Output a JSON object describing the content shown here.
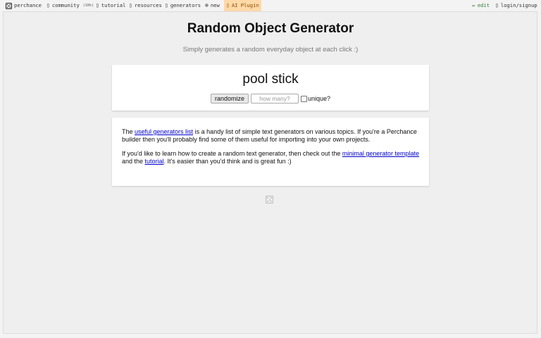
{
  "nav": {
    "brand": "perchance",
    "community": "community",
    "community_count": "(10h)",
    "tutorial": "tutorial",
    "resources": "resources",
    "generators": "generators",
    "new": "new",
    "ai_plugin": "AI Plugin",
    "edit": "edit",
    "login": "login/signup"
  },
  "page": {
    "title": "Random Object Generator",
    "subtitle": "Simply generates a random everyday object at each click :)"
  },
  "generator": {
    "result": "pool stick",
    "randomize_label": "randomize",
    "count_placeholder": "how many?",
    "unique_label": "unique?"
  },
  "info": {
    "p1_before": "The ",
    "p1_link": "useful generators list",
    "p1_after": " is a handy list of simple text generators on various topics. If you're a Perchance builder then you'll probably find some of them useful for importing into your own projects.",
    "p2_before": "If you'd like to learn how to create a random text generator, then check out the ",
    "p2_link1": "minimal generator template",
    "p2_mid": " and the ",
    "p2_link2": "tutorial",
    "p2_after": ". It's easier than you'd think and is great fun :)"
  },
  "icons": {
    "brand": "dice-icon",
    "community": "chat-icon",
    "tutorial": "book-icon",
    "resources": "toolbox-icon",
    "generators": "list-icon",
    "new": "plus-circle-icon",
    "ai_plugin": "robot-icon",
    "edit": "pencil-icon",
    "login": "user-icon",
    "footer": "dice-icon"
  }
}
